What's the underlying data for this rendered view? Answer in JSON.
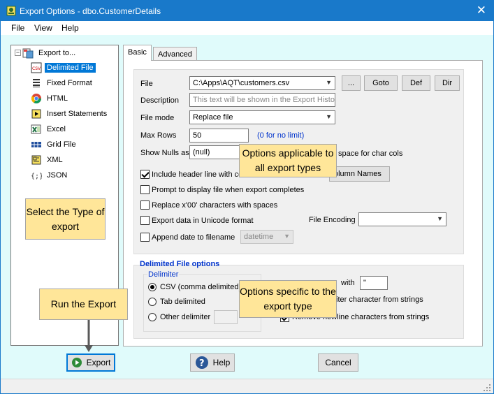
{
  "window": {
    "title": "Export Options - dbo.CustomerDetails",
    "close_glyph": "✕",
    "icon": "app-icon"
  },
  "menu": [
    "File",
    "View",
    "Help"
  ],
  "tree": {
    "root_label": "Export to...",
    "expander": "−",
    "items": [
      {
        "label": "Delimited File",
        "icon": "csv-file-icon",
        "selected": true
      },
      {
        "label": "Fixed Format",
        "icon": "fixed-format-icon",
        "selected": false
      },
      {
        "label": "HTML",
        "icon": "chrome-icon",
        "selected": false
      },
      {
        "label": "Insert Statements",
        "icon": "sql-insert-icon",
        "selected": false
      },
      {
        "label": "Excel",
        "icon": "excel-icon",
        "selected": false
      },
      {
        "label": "Grid File",
        "icon": "grid-file-icon",
        "selected": false
      },
      {
        "label": "XML",
        "icon": "xml-icon",
        "selected": false
      },
      {
        "label": "JSON",
        "icon": "json-icon",
        "selected": false
      }
    ]
  },
  "tabs": [
    "Basic",
    "Advanced"
  ],
  "basic": {
    "file_label": "File",
    "file_value": "C:\\Apps\\AQT\\customers.csv",
    "browse_label": "...",
    "goto_label": "Goto",
    "def_label": "Def",
    "dir_label": "Dir",
    "description_label": "Description",
    "description_placeholder": "This text will be shown in the Export History",
    "filemode_label": "File mode",
    "filemode_value": "Replace file",
    "maxrows_label": "Max Rows",
    "maxrows_value": "50",
    "maxrows_hint": "(0 for no limit)",
    "shownulls_label": "Show Nulls as",
    "shownulls_value": "(null)",
    "shownulls_suffix": "space for char cols",
    "include_header_label": "Include header line with co",
    "include_header_checked": true,
    "column_names_label": "olumn Names",
    "prompt_label": "Prompt to display file when export completes",
    "prompt_checked": false,
    "replace_label": "Replace x'00' characters with spaces",
    "replace_checked": false,
    "unicode_label": "Export data in Unicode format",
    "unicode_checked": false,
    "encoding_label": "File Encoding",
    "encoding_value": "",
    "append_label": "Append date to filename",
    "append_checked": false,
    "date_format_value": "datetime"
  },
  "delimited": {
    "section_title": "Delimited File options",
    "delimiter_group": "Delimiter",
    "options": [
      {
        "label": "CSV (comma delimited)",
        "selected": true
      },
      {
        "label": "Tab delimited",
        "selected": false
      },
      {
        "label": "Other delimiter",
        "selected": false
      }
    ],
    "other_value": "",
    "quote_suffix": "with",
    "quote_value": "\"",
    "strip_label": "iter character from strings",
    "remove_newline_label": "Remove newline characters from strings",
    "remove_newline_checked": true
  },
  "callouts": {
    "all_types": "Options applicable to all export types",
    "select_type": "Select the Type of export",
    "run_export": "Run the Export",
    "specific": "Options specific to the export type"
  },
  "buttons": {
    "export": "Export",
    "help": "Help",
    "cancel": "Cancel"
  },
  "colors": {
    "titlebar": "#1979ca",
    "selection": "#0078d7",
    "callout": "#ffe699",
    "client_bg": "#e0fbfb",
    "hint": "#0033cc"
  }
}
